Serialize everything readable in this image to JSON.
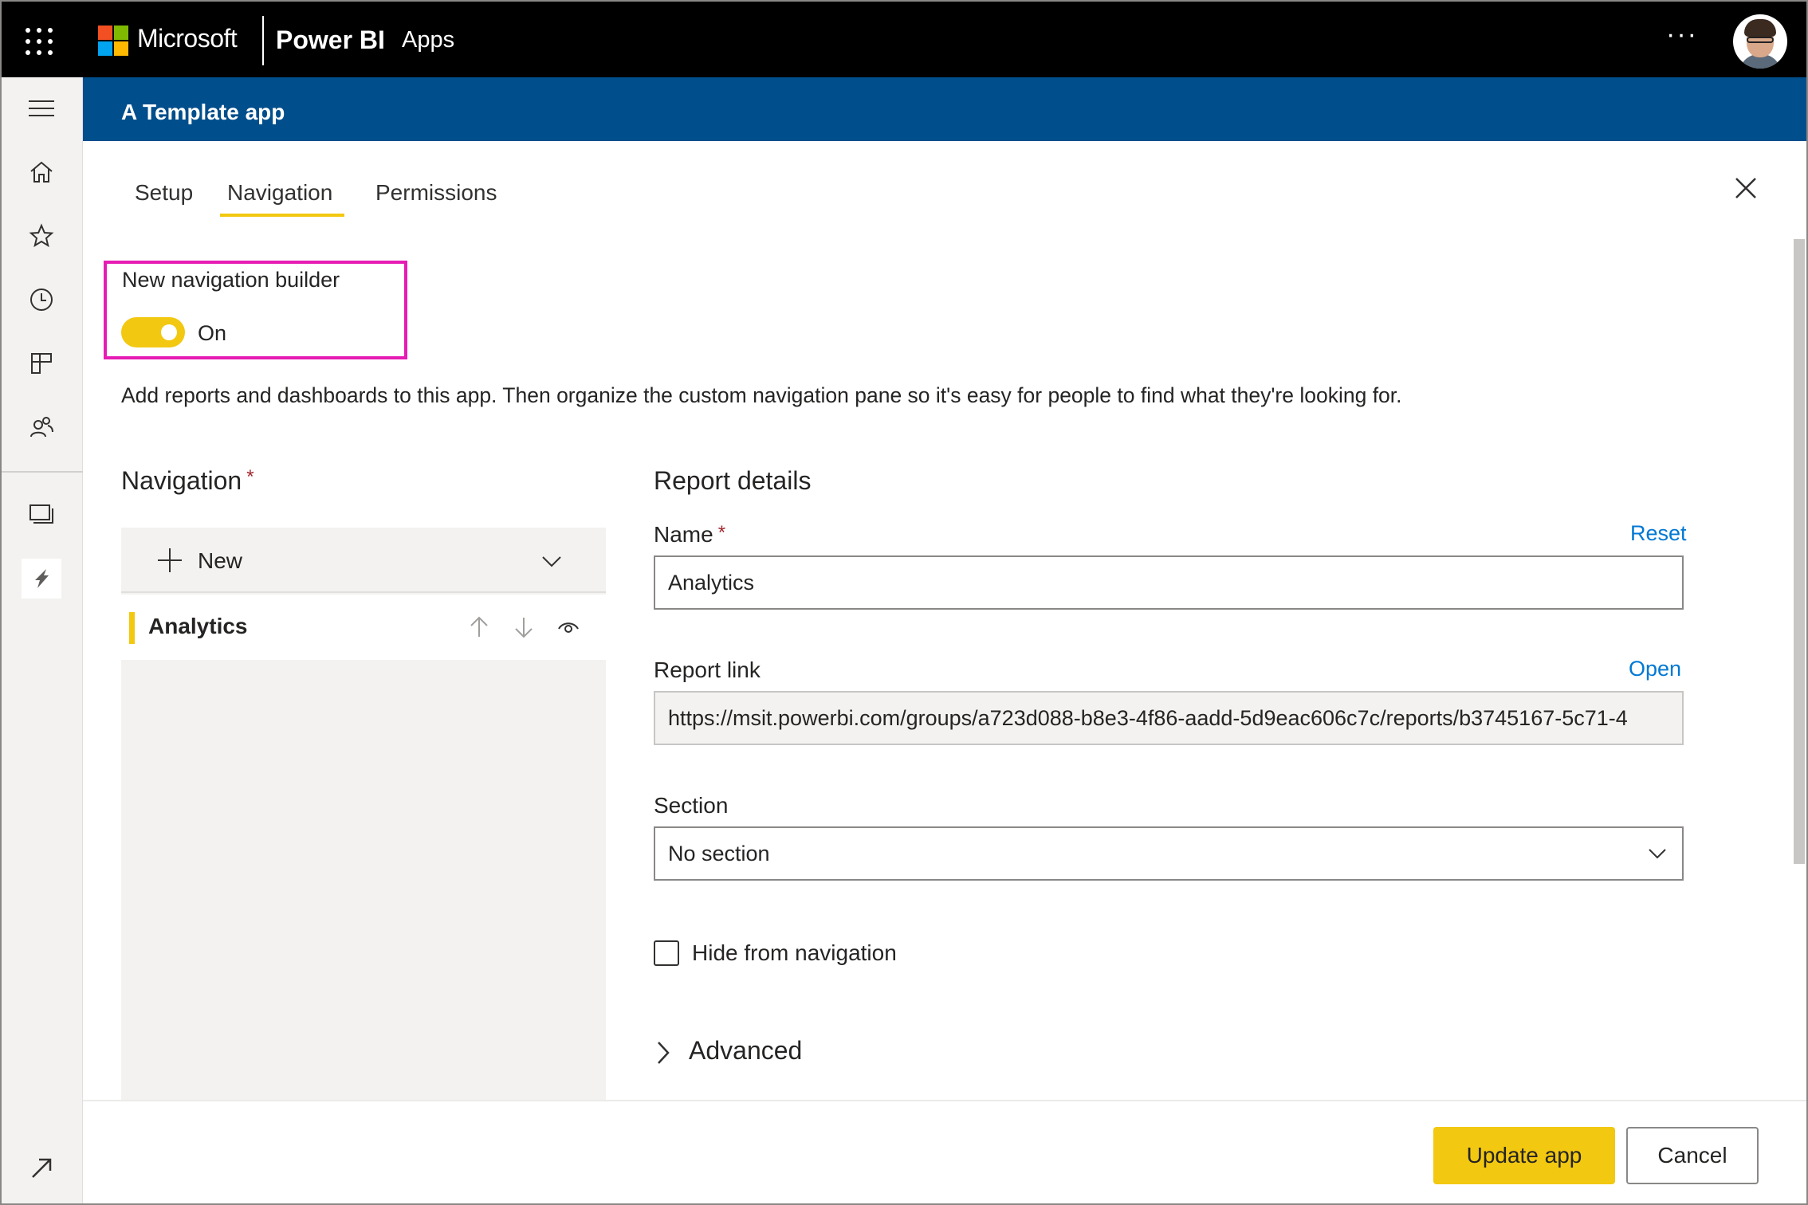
{
  "topbar": {
    "brand_company": "Microsoft",
    "brand_product": "Power BI",
    "section": "Apps",
    "more_label": "···",
    "icons": [
      "app-launcher-icon",
      "microsoft-logo-icon",
      "more-options-icon",
      "avatar"
    ]
  },
  "left_rail": {
    "items": [
      "hamburger-icon",
      "home-icon",
      "favorites-star-icon",
      "recent-clock-icon",
      "apps-icon",
      "shared-with-me-icon",
      "workspaces-icon",
      "current-workspace-icon",
      "expand-arrow-icon"
    ]
  },
  "app_header": {
    "title": "A Template app"
  },
  "tabs": [
    {
      "label": "Setup",
      "active": false
    },
    {
      "label": "Navigation",
      "active": true
    },
    {
      "label": "Permissions",
      "active": false
    }
  ],
  "new_nav_builder": {
    "label": "New navigation builder",
    "toggle_state": "On",
    "enabled": true
  },
  "description": "Add reports and dashboards to this app. Then organize the custom navigation pane so it's easy for people to find what they're looking for.",
  "navigation_panel": {
    "heading": "Navigation",
    "required_mark": "*",
    "new_label": "New",
    "items": [
      {
        "label": "Analytics",
        "selected": true
      }
    ]
  },
  "report_details": {
    "heading": "Report details",
    "name_label": "Name",
    "name_required": "*",
    "reset_link": "Reset",
    "name_value": "Analytics",
    "link_label": "Report link",
    "open_link": "Open",
    "link_value": "https://msit.powerbi.com/groups/a723d088-b8e3-4f86-aadd-5d9eac606c7c/reports/b3745167-5c71-4",
    "section_label": "Section",
    "section_value": "No section",
    "hide_label": "Hide from navigation",
    "hide_checked": false,
    "advanced_label": "Advanced"
  },
  "footer": {
    "update_label": "Update app",
    "cancel_label": "Cancel"
  },
  "colors": {
    "topbar": "#000000",
    "app_header": "#004e8c",
    "accent_yellow": "#f2c811",
    "highlight_box": "#e61cb4",
    "link_blue": "#0078d4"
  }
}
